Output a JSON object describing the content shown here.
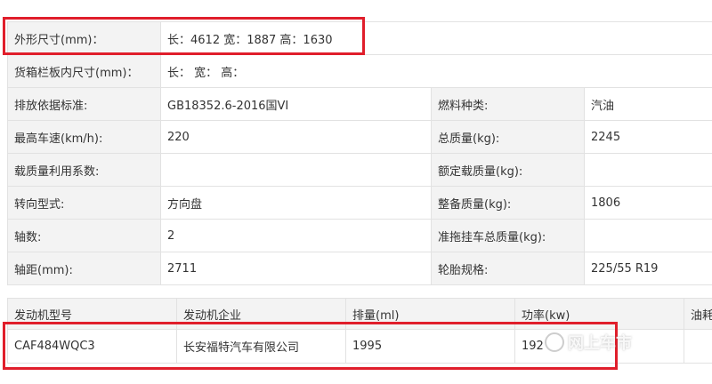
{
  "specs": {
    "dimensions_label": "外形尺寸(mm)：",
    "dimensions_value": "长：4612 宽：1887 高：1630",
    "cargo_label": "货箱栏板内尺寸(mm)：",
    "cargo_value": "长： 宽： 高：",
    "emission_label": "排放依据标准:",
    "emission_value": "GB18352.6-2016国VI",
    "fuel_label": "燃料种类:",
    "fuel_value": "汽油",
    "speed_label": "最高车速(km/h):",
    "speed_value": "220",
    "total_mass_label": "总质量(kg):",
    "total_mass_value": "2245",
    "load_ratio_label": "载质量利用系数:",
    "load_ratio_value": "",
    "rated_load_label": "额定载质量(kg):",
    "rated_load_value": "",
    "steering_label": "转向型式:",
    "steering_value": "方向盘",
    "curb_mass_label": "整备质量(kg):",
    "curb_mass_value": "1806",
    "axles_label": "轴数:",
    "axles_value": "2",
    "trailer_mass_label": "准拖挂车总质量(kg):",
    "trailer_mass_value": "",
    "wheelbase_label": "轴距(mm):",
    "wheelbase_value": "2711",
    "tire_label": "轮胎规格:",
    "tire_value": "225/55 R19"
  },
  "engine": {
    "headers": [
      "发动机型号",
      "发动机企业",
      "排量(ml)",
      "功率(kw)",
      "油耗"
    ],
    "row": [
      "CAF484WQC3",
      "长安福特汽车有限公司",
      "1995",
      "192",
      ""
    ]
  },
  "watermark": {
    "text": "网上车市"
  },
  "colors": {
    "highlight": "#e01e2b",
    "label_bg": "#f3f3f3",
    "border": "#e2e2e2"
  }
}
